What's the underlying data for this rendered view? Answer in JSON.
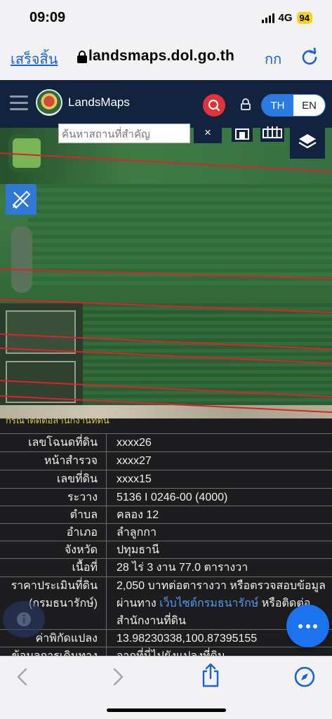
{
  "status_bar": {
    "time": "09:09",
    "network": "4G",
    "battery": "94"
  },
  "browser": {
    "done_label": "เสร็จสิ้น",
    "url": "landsmaps.dol.go.th",
    "text_size_label": "กก"
  },
  "header": {
    "brand": "LandsMaps",
    "lang_th": "TH",
    "lang_en": "EN"
  },
  "map": {
    "search_placeholder": "ค้นหาสถานที่สำคัญ",
    "clear_label": "×"
  },
  "parcel": {
    "cut_title": "กรุณาติดต่อสำนักงานที่ดิน",
    "rows": [
      {
        "label": "เลขโฉนดที่ดิน",
        "value": "xxxx26"
      },
      {
        "label": "หน้าสำรวจ",
        "value": "xxxx27"
      },
      {
        "label": "เลขที่ดิน",
        "value": "xxxx15"
      },
      {
        "label": "ระวาง",
        "value": "5136 I 0246-00 (4000)"
      },
      {
        "label": "ตำบล",
        "value": "คลอง 12"
      },
      {
        "label": "อำเภอ",
        "value": "ลำลูกกา"
      },
      {
        "label": "จังหวัด",
        "value": "ปทุมธานี"
      },
      {
        "label": "เนื้อที่",
        "value": "28 ไร่ 3 งาน 77.0 ตารางวา"
      }
    ],
    "price": {
      "label_line1": "ราคาประเมินที่ดิน",
      "label_line2": "(กรมธนารักษ์)",
      "value_pre": "2,050 บาทต่อตารางวา หรือตรวจสอบข้อมูลผ่านทาง ",
      "value_link": "เว็บไซต์กรมธนารักษ์",
      "value_post": " หรือติดต่อสำนักงานที่ดิน"
    },
    "coords": {
      "label": "ค่าพิกัดแปลง",
      "value": "13.98230338,100.87395155"
    },
    "route": {
      "label": "ข้อมูลการเดินทาง",
      "value": "จากที่นี่ไปยังแปลงที่ดิน"
    }
  },
  "colors": {
    "accent": "#1b73f0",
    "header_bg": "#11233f",
    "danger": "#e3333a",
    "link": "#4f9cf1"
  }
}
